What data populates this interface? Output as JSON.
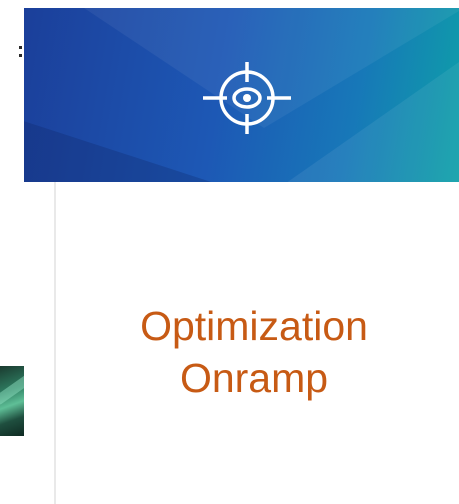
{
  "card": {
    "title_line_1": "Optimization",
    "title_line_2": "Onramp",
    "banner_icon": "target-crosshair-icon"
  },
  "colors": {
    "title": "#c75a14",
    "banner_start": "#1b3f9a",
    "banner_end": "#0ea0a8"
  }
}
